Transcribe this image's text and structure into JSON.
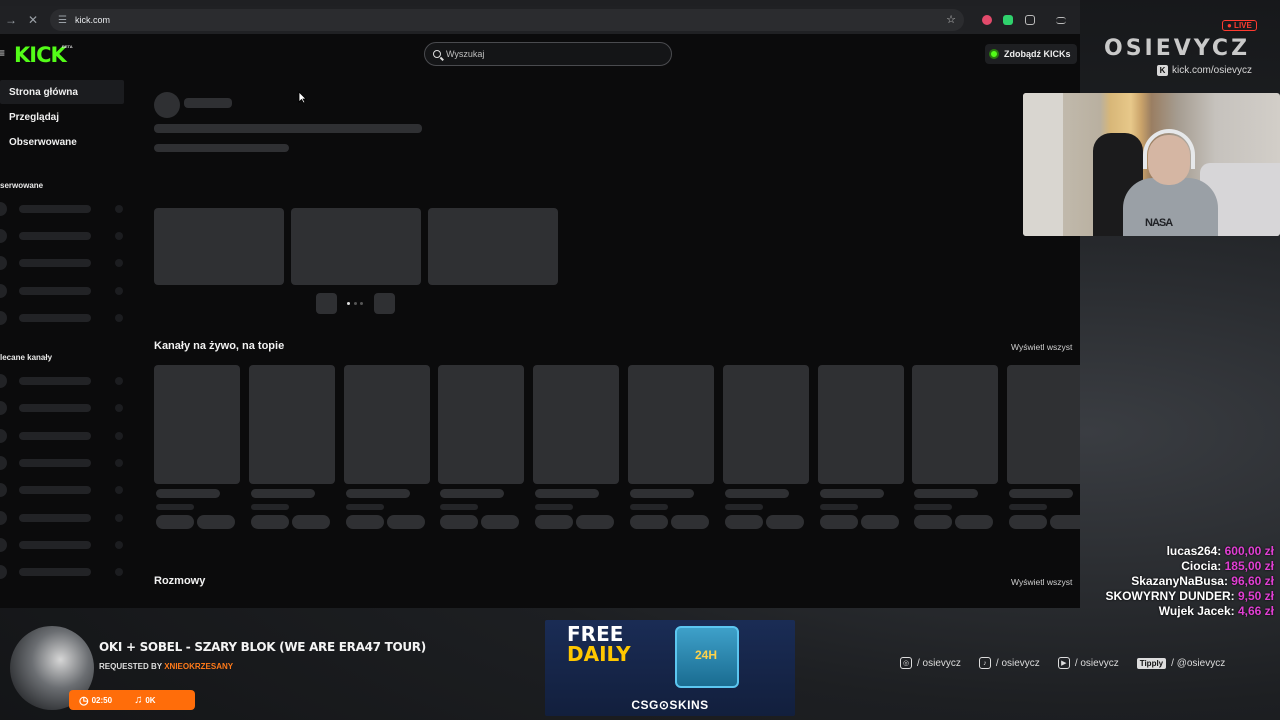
{
  "browser": {
    "url": "kick.com",
    "reload_icon": "close-icon"
  },
  "header": {
    "logo": "KICK",
    "beta": "BETA",
    "search_placeholder": "Wyszukaj",
    "kicks_button": "Zdobądź KICKs"
  },
  "sidebar": {
    "items": [
      {
        "label": "Strona główna",
        "active": true
      },
      {
        "label": "Przeglądaj",
        "active": false
      },
      {
        "label": "Obserwowane",
        "active": false
      }
    ],
    "followed_title": "serwowane",
    "recommended_title": "lecane kanały"
  },
  "main": {
    "live_section_title": "Kanały na żywo, na topie",
    "live_see_all": "Wyświetl wszyst",
    "chats_section_title": "Rozmowy",
    "chats_see_all": "Wyświetl wszyst"
  },
  "overlay": {
    "streamer_name": "OSIEVYCZ",
    "live_badge": "● LIVE",
    "kick_handle": "kick.com/osievycz",
    "webcam_shirt_text": "NASA",
    "donations": [
      {
        "user": "lucas264:",
        "amount": "600,00 zł"
      },
      {
        "user": "Ciocia:",
        "amount": "185,00 zł"
      },
      {
        "user": "SkazanyNaBusa:",
        "amount": "96,60 zł"
      },
      {
        "user": "SKOWYRNY DUNDER:",
        "amount": "9,50 zł"
      },
      {
        "user": "Wujek Jacek:",
        "amount": "4,66 zł"
      }
    ]
  },
  "now_playing": {
    "title": "OKI + SOBEL - SZARY BLOK (WE ARE ERA47 TOUR)",
    "requested_label": "REQUESTED BY",
    "requested_user": "XNIEOKRZESANY",
    "time": "02:50",
    "count": "0K"
  },
  "ad": {
    "line1": "FREE",
    "line2": "DAILY",
    "crate_label": "24H",
    "brand": "CSG⊙SKINS"
  },
  "socials": [
    {
      "icon": "instagram-icon",
      "glyph": "◎",
      "handle": "/ osievycz"
    },
    {
      "icon": "tiktok-icon",
      "glyph": "♪",
      "handle": "/ osievycz"
    },
    {
      "icon": "youtube-icon",
      "glyph": "▶",
      "handle": "/ osievycz"
    },
    {
      "icon": "tipply-icon",
      "glyph": "Tipply",
      "handle": "/ @osievycz"
    }
  ]
}
